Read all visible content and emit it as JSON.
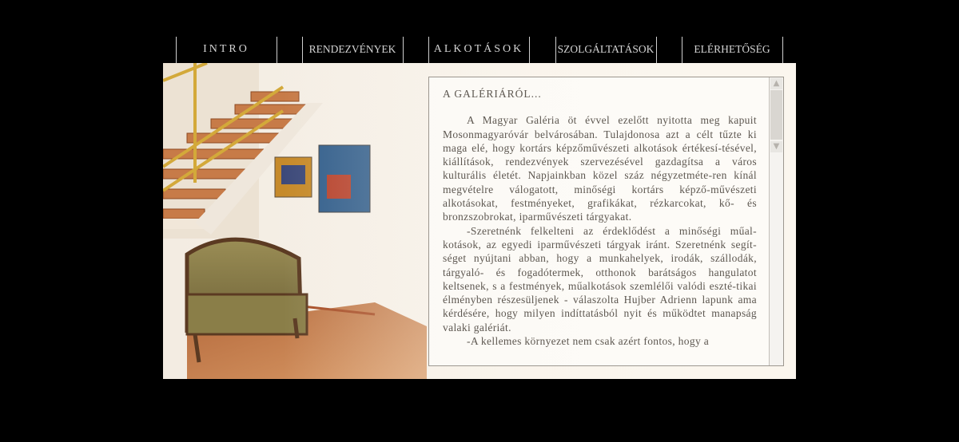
{
  "nav": {
    "items": [
      {
        "label": "INTRO"
      },
      {
        "label": "RENDEZVÉNYEK"
      },
      {
        "label": "ALKOTÁSOK"
      },
      {
        "label": "SZOLGÁLTATÁSOK"
      },
      {
        "label": "ELÉRHETŐSÉG"
      }
    ]
  },
  "article": {
    "heading": "A GALÉRIÁRÓL...",
    "paragraphs": [
      "A Magyar Galéria öt évvel ezelőtt nyitotta meg kapuit Mosonmagyaróvár belvárosában. Tulajdonosa azt a célt tűzte ki maga elé, hogy kortárs képzőművészeti alkotások értékesí-tésével, kiállítások, rendezvények szervezésével gazdagítsa a város kulturális életét. Napjainkban közel száz négyzetméte-ren kínál megvételre válogatott, minőségi kortárs képző-művészeti alkotásokat, festményeket, grafikákat, rézkarcokat, kő- és bronzszobrokat, iparművészeti tárgyakat.",
      "-Szeretnénk felkelteni az érdeklődést a minőségi műal-kotások, az egyedi iparművészeti tárgyak iránt. Szeretnénk segít-séget nyújtani abban, hogy a munkahelyek, irodák, szállodák, tárgyaló- és fogadótermek, otthonok barátságos hangulatot keltsenek, s a festmények, műalkotások szemlélői valódi eszté-tikai élményben részesüljenek - válaszolta Hujber Adrienn lapunk ama kérdésére, hogy milyen indíttatásból nyit és működtet manapság valaki galériát.",
      "-A kellemes környezet nem csak azért fontos, hogy a"
    ]
  },
  "scrollbar": {
    "up_icon": "▲",
    "down_icon": "▼",
    "position": 0
  },
  "colors": {
    "background": "#000000",
    "nav_text": "#d4d4d4",
    "panel": "#fbf6ee",
    "text": "#5d5750",
    "frame": "#9c978f"
  }
}
